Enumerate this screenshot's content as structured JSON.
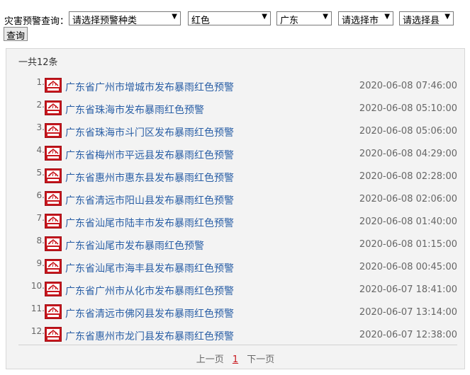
{
  "filter": {
    "label": "灾害预警查询：",
    "warning_type": "请选择预警种类",
    "color": "红色",
    "province": "广东",
    "city": "请选择市",
    "county": "请选择县",
    "query_button": "查询"
  },
  "results": {
    "total_text": "一共12条",
    "icon": "rainstorm-red-warning-icon",
    "accent_color": "#c8161d",
    "link_color": "#2a5fa6",
    "items": [
      {
        "num": "1.",
        "title": "广东省广州市增城市发布暴雨红色预警",
        "time": "2020-06-08 07:46:00"
      },
      {
        "num": "2.",
        "title": "广东省珠海市发布暴雨红色预警",
        "time": "2020-06-08 05:10:00"
      },
      {
        "num": "3.",
        "title": "广东省珠海市斗门区发布暴雨红色预警",
        "time": "2020-06-08 05:06:00"
      },
      {
        "num": "4.",
        "title": "广东省梅州市平远县发布暴雨红色预警",
        "time": "2020-06-08 04:29:00"
      },
      {
        "num": "5.",
        "title": "广东省惠州市惠东县发布暴雨红色预警",
        "time": "2020-06-08 02:28:00"
      },
      {
        "num": "6.",
        "title": "广东省清远市阳山县发布暴雨红色预警",
        "time": "2020-06-08 02:06:00"
      },
      {
        "num": "7.",
        "title": "广东省汕尾市陆丰市发布暴雨红色预警",
        "time": "2020-06-08 01:40:00"
      },
      {
        "num": "8.",
        "title": "广东省汕尾市发布暴雨红色预警",
        "time": "2020-06-08 01:15:00"
      },
      {
        "num": "9.",
        "title": "广东省汕尾市海丰县发布暴雨红色预警",
        "time": "2020-06-08 00:45:00"
      },
      {
        "num": "10.",
        "title": "广东省广州市从化市发布暴雨红色预警",
        "time": "2020-06-07 18:41:00"
      },
      {
        "num": "11.",
        "title": "广东省清远市佛冈县发布暴雨红色预警",
        "time": "2020-06-07 13:14:00"
      },
      {
        "num": "12.",
        "title": "广东省惠州市龙门县发布暴雨红色预警",
        "time": "2020-06-07 12:38:00"
      }
    ]
  },
  "pager": {
    "prev": "上一页",
    "current": "1",
    "next": "下一页"
  }
}
